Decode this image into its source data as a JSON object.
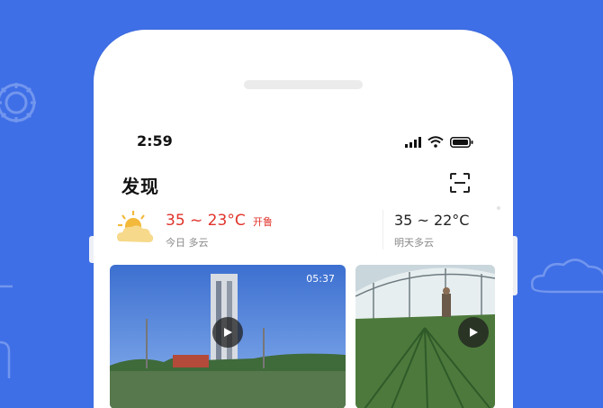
{
  "colors": {
    "background": "#3f6fe6",
    "accent_red": "#e0332b"
  },
  "status_bar": {
    "time": "2:59",
    "icons": [
      "cellular-signal-icon",
      "wifi-icon",
      "battery-icon"
    ]
  },
  "page": {
    "title": "发现",
    "scan_icon": "scan-icon"
  },
  "weather": {
    "today": {
      "temp": "35 ~ 23°C",
      "badge": "开鲁",
      "desc": "今日 多云",
      "icon": "partly-cloudy-icon"
    },
    "tomorrow": {
      "temp": "35 ~ 22°C",
      "desc": "明天多云"
    }
  },
  "videos": [
    {
      "duration": "05:37",
      "scene": "monument",
      "play_icon": "play-icon"
    },
    {
      "duration": "",
      "scene": "greenhouse",
      "play_icon": "play-icon"
    }
  ]
}
